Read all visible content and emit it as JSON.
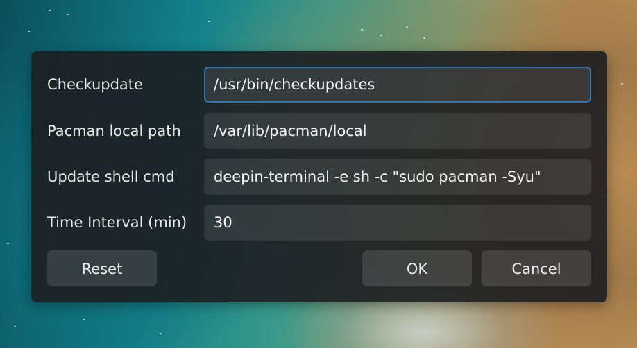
{
  "dialog": {
    "fields": [
      {
        "label": "Checkupdate",
        "value": "/usr/bin/checkupdates"
      },
      {
        "label": "Pacman local path",
        "value": "/var/lib/pacman/local"
      },
      {
        "label": "Update shell cmd",
        "value": "deepin-terminal -e sh -c \"sudo pacman -Syu\""
      },
      {
        "label": "Time Interval (min)",
        "value": "30"
      }
    ],
    "buttons": {
      "reset": "Reset",
      "ok": "OK",
      "cancel": "Cancel"
    }
  },
  "colors": {
    "dialog_bg": "#1c1e20",
    "focus_border": "#2f74b5",
    "text": "#e8e8e8"
  }
}
